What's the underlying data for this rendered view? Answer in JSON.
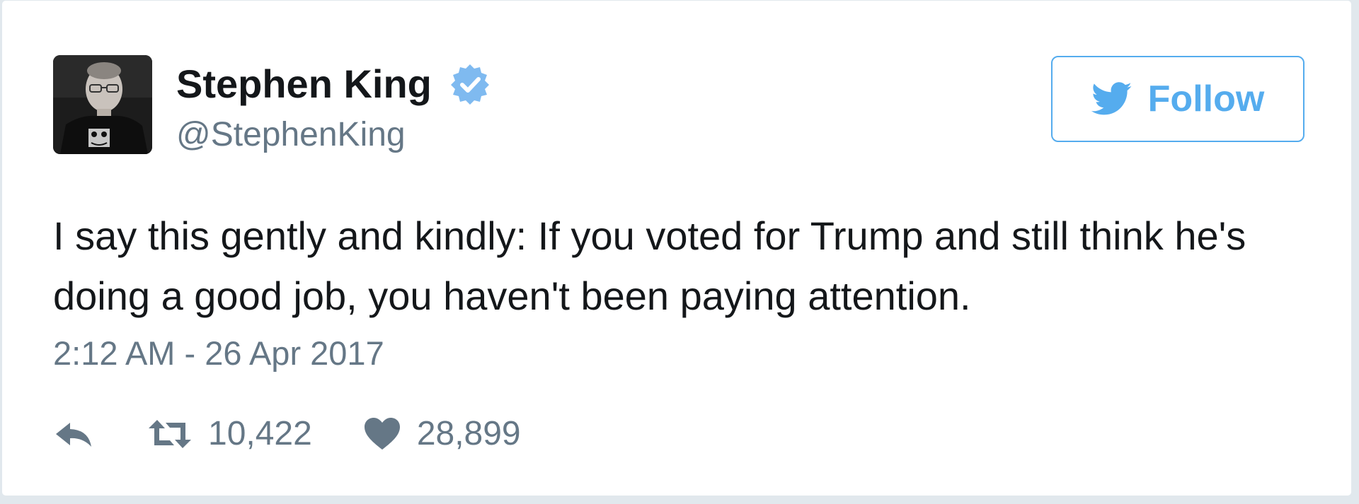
{
  "tweet": {
    "author": {
      "display_name": "Stephen King",
      "handle": "@StephenKing",
      "verified": true,
      "avatar_icon": "author-avatar"
    },
    "follow_button": {
      "label": "Follow",
      "icon": "twitter-bird-icon"
    },
    "text": "I say this gently and kindly: If you voted for Trump and still think he's doing a good job, you haven't been paying attention.",
    "timestamp": "2:12 AM - 26 Apr 2017",
    "actions": {
      "reply_icon": "reply-icon",
      "retweet_icon": "retweet-icon",
      "retweet_count": "10,422",
      "like_icon": "heart-icon",
      "like_count": "28,899"
    }
  },
  "colors": {
    "twitter_blue": "#55acee",
    "verified_blue": "#7fbaf0",
    "text_primary": "#14171a",
    "text_secondary": "#657786",
    "border": "#e1e8ed"
  }
}
